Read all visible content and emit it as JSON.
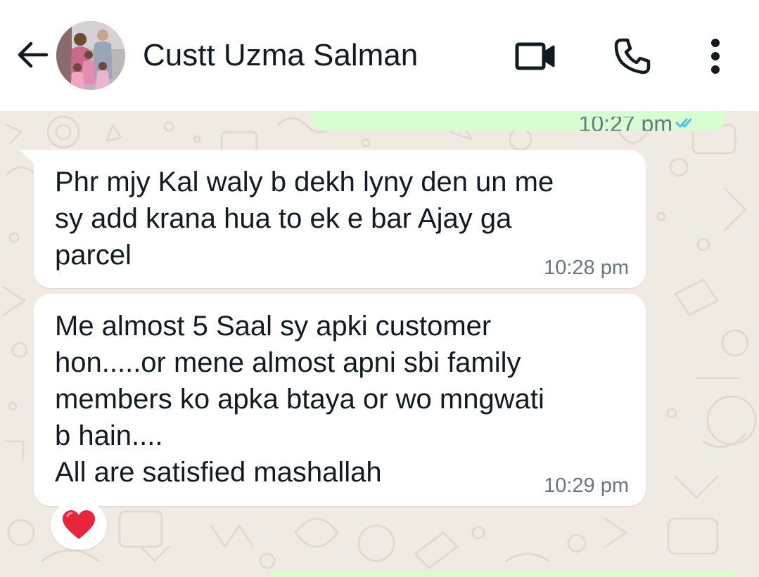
{
  "header": {
    "contact_name": "Custt Uzma Salman",
    "back_icon": "arrow-left-icon",
    "video_icon": "video-camera-icon",
    "call_icon": "phone-icon",
    "menu_icon": "more-vertical-icon"
  },
  "messages": [
    {
      "direction": "outgoing",
      "time": "10:27 pm",
      "status": "read"
    },
    {
      "direction": "incoming",
      "text": "Phr mjy Kal waly b dekh lyny den un me\nsy add krana hua to ek e bar Ajay ga\nparcel",
      "time": "10:28 pm"
    },
    {
      "direction": "incoming",
      "text": "Me almost 5 Saal sy apki customer\nhon.....or mene almost apni sbi family\nmembers ko apka btaya or wo mngwati\nb hain....\nAll are satisfied mashallah",
      "time": "10:29 pm",
      "reaction": "heart"
    }
  ],
  "colors": {
    "chat_background": "#efeae2",
    "incoming_bubble": "#ffffff",
    "outgoing_bubble": "#d9fdd3",
    "text_primary": "#111b21",
    "text_secondary": "#667781",
    "read_ticks": "#53bdeb",
    "heart": "#e8253a"
  }
}
